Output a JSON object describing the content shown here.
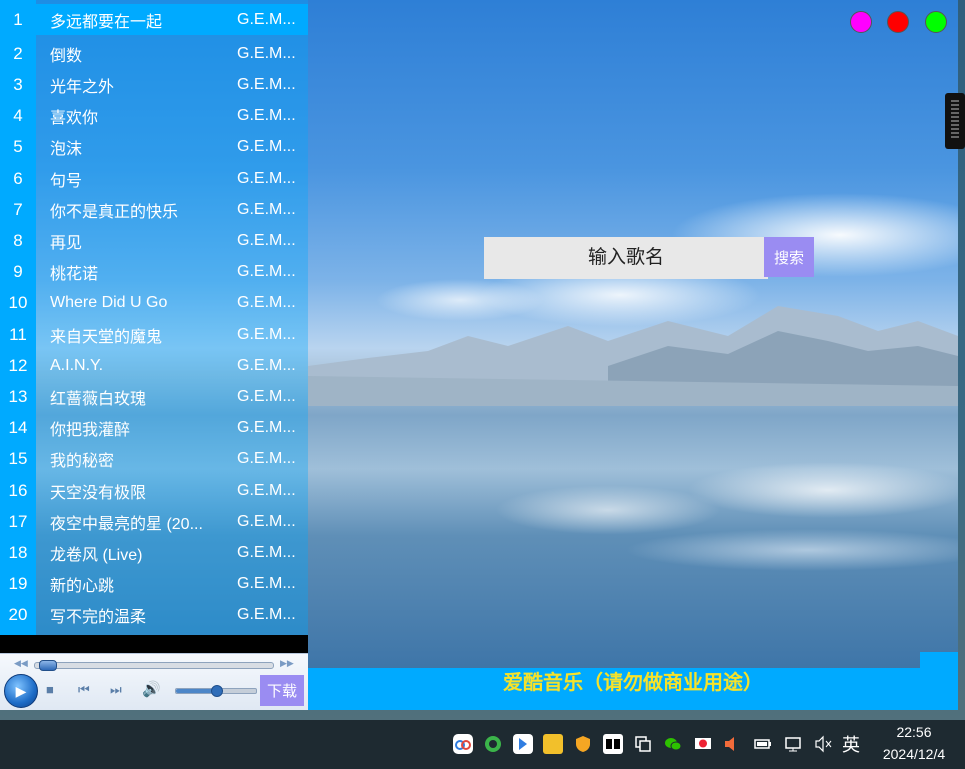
{
  "playlist": {
    "songs": [
      {
        "idx": "1",
        "title": "多远都要在一起",
        "artist": "G.E.M..."
      },
      {
        "idx": "2",
        "title": "倒数",
        "artist": "G.E.M..."
      },
      {
        "idx": "3",
        "title": "光年之外",
        "artist": "G.E.M..."
      },
      {
        "idx": "4",
        "title": "喜欢你",
        "artist": "G.E.M..."
      },
      {
        "idx": "5",
        "title": "泡沫",
        "artist": "G.E.M..."
      },
      {
        "idx": "6",
        "title": "句号",
        "artist": "G.E.M..."
      },
      {
        "idx": "7",
        "title": "你不是真正的快乐",
        "artist": "G.E.M..."
      },
      {
        "idx": "8",
        "title": "再见",
        "artist": "G.E.M..."
      },
      {
        "idx": "9",
        "title": "桃花诺",
        "artist": "G.E.M..."
      },
      {
        "idx": "10",
        "title": "Where Did U Go",
        "artist": "G.E.M..."
      },
      {
        "idx": "11",
        "title": "来自天堂的魔鬼",
        "artist": "G.E.M..."
      },
      {
        "idx": "12",
        "title": "A.I.N.Y.",
        "artist": "G.E.M..."
      },
      {
        "idx": "13",
        "title": "红蔷薇白玫瑰",
        "artist": "G.E.M..."
      },
      {
        "idx": "14",
        "title": "你把我灌醉",
        "artist": "G.E.M..."
      },
      {
        "idx": "15",
        "title": "我的秘密",
        "artist": "G.E.M..."
      },
      {
        "idx": "16",
        "title": "天空没有极限",
        "artist": "G.E.M..."
      },
      {
        "idx": "17",
        "title": "夜空中最亮的星 (20...",
        "artist": "G.E.M..."
      },
      {
        "idx": "18",
        "title": "龙卷风 (Live)",
        "artist": "G.E.M..."
      },
      {
        "idx": "19",
        "title": "新的心跳",
        "artist": "G.E.M..."
      },
      {
        "idx": "20",
        "title": "写不完的温柔",
        "artist": "G.E.M..."
      }
    ],
    "active_index": 0
  },
  "player": {
    "progress": 0.02,
    "volume": 0.5,
    "download_label": "下载",
    "icons": {
      "play": "play-icon",
      "stop": "stop-icon",
      "prev": "previous-icon",
      "next": "next-icon",
      "volume": "volume-icon",
      "seek_back": "rewind-icon",
      "seek_forward": "fast-forward-icon"
    }
  },
  "window_controls": [
    {
      "name": "magenta-dot",
      "color": "#ff00ff"
    },
    {
      "name": "red-dot",
      "color": "#ff0000"
    },
    {
      "name": "green-dot",
      "color": "#00ff00"
    }
  ],
  "search": {
    "placeholder": "输入歌名",
    "button_label": "搜索"
  },
  "footer": {
    "text": "爱酷音乐（请勿做商业用途）"
  },
  "taskbar": {
    "ime_label": "英",
    "time": "22:56",
    "date": "2024/12/4"
  },
  "colors": {
    "accent_blue": "#00aaff",
    "button_purple": "#9a8cf2",
    "footer_text": "#f5e22a"
  }
}
